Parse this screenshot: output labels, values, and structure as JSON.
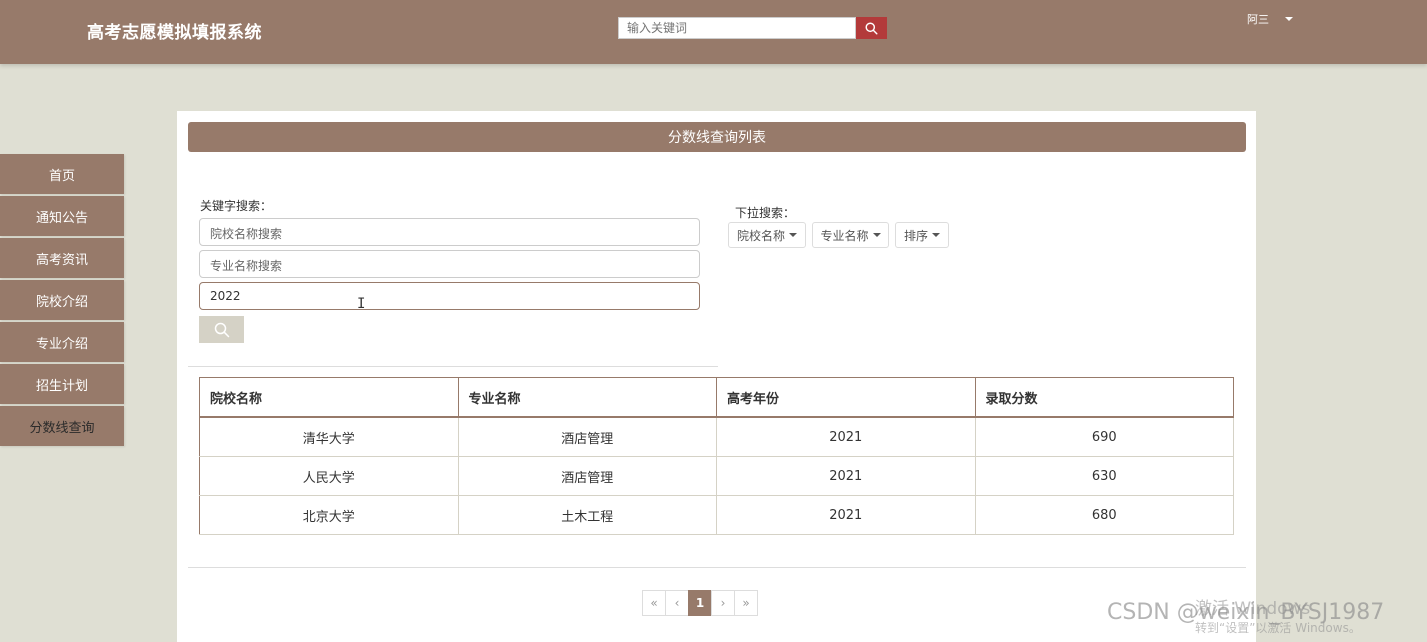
{
  "header": {
    "site_title": "高考志愿模拟填报系统",
    "search_placeholder": "输入关键词",
    "user_label": "阿三"
  },
  "sidebar": {
    "items": [
      {
        "label": "首页"
      },
      {
        "label": "通知公告"
      },
      {
        "label": "高考资讯"
      },
      {
        "label": "院校介绍"
      },
      {
        "label": "专业介绍"
      },
      {
        "label": "招生计划"
      },
      {
        "label": "分数线查询",
        "active": true
      }
    ]
  },
  "panel": {
    "title": "分数线查询列表",
    "keyword_label": "关键字搜索：",
    "school_placeholder": "院校名称搜索",
    "major_placeholder": "专业名称搜索",
    "year_value": "2022",
    "dropdown_label": "下拉搜索：",
    "dropdowns": [
      "院校名称",
      "专业名称",
      "排序"
    ]
  },
  "table": {
    "headers": [
      "院校名称",
      "专业名称",
      "高考年份",
      "录取分数"
    ],
    "rows": [
      [
        "清华大学",
        "酒店管理",
        "2021",
        "690"
      ],
      [
        "人民大学",
        "酒店管理",
        "2021",
        "630"
      ],
      [
        "北京大学",
        "土木工程",
        "2021",
        "680"
      ]
    ]
  },
  "pagination": {
    "first": "«",
    "prev": "‹",
    "current": "1",
    "next": "›",
    "last": "»"
  },
  "watermarks": {
    "activate": "激活 Windows",
    "activate_sub": "转到“设置”以激活 Windows。",
    "csdn": "CSDN @weixin_BYSJ1987"
  },
  "colors": {
    "brand": "#977a6a",
    "background": "#dfdfd3",
    "search_button": "#b33a3a"
  }
}
